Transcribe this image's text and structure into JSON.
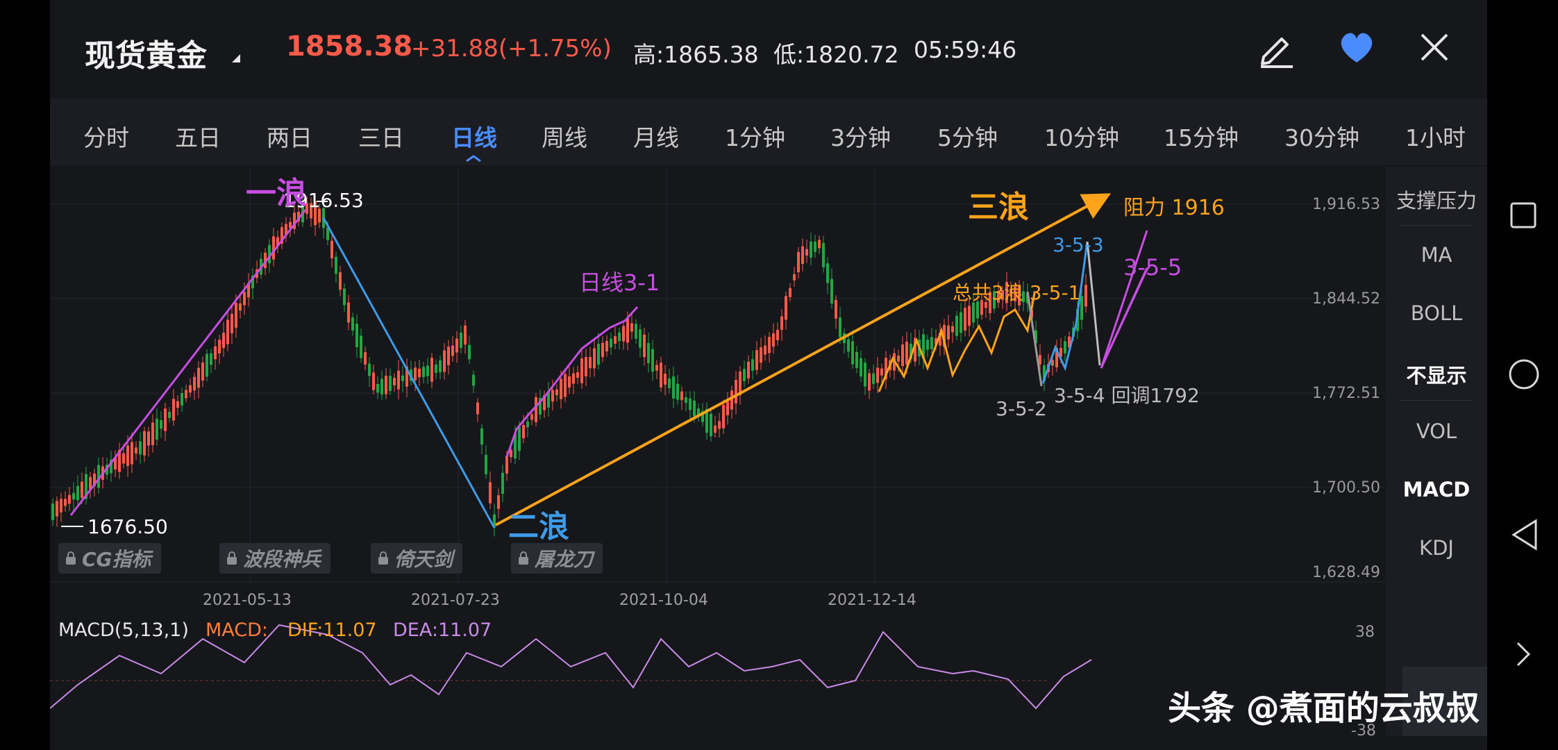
{
  "header": {
    "title": "现货黄金",
    "price": "1858.38",
    "change": "+31.88(+1.75%)",
    "high": "高:1865.38",
    "low": "低:1820.72",
    "time": "05:59:46"
  },
  "tabs": [
    {
      "label": "分时"
    },
    {
      "label": "五日"
    },
    {
      "label": "两日"
    },
    {
      "label": "三日"
    },
    {
      "label": "日线",
      "active": true
    },
    {
      "label": "周线"
    },
    {
      "label": "月线"
    },
    {
      "label": "1分钟"
    },
    {
      "label": "3分钟"
    },
    {
      "label": "5分钟"
    },
    {
      "label": "10分钟"
    },
    {
      "label": "15分钟"
    },
    {
      "label": "30分钟"
    },
    {
      "label": "1小时"
    }
  ],
  "side_panel": [
    "支撑压力",
    "MA",
    "BOLL",
    "不显示",
    "VOL",
    "MACD",
    "KDJ"
  ],
  "price_axis": [
    "1,916.53",
    "1,844.52",
    "1,772.51",
    "1,700.50",
    "1,628.49"
  ],
  "date_axis": [
    "2021-05-13",
    "2021-07-23",
    "2021-10-04",
    "2021-12-14"
  ],
  "markers": {
    "high": "1916.53",
    "low": "1676.50"
  },
  "indicator_badges": [
    "CG指标",
    "波段神兵",
    "倚天剑",
    "屠龙刀"
  ],
  "annotations": {
    "wave1": "一浪",
    "wave2": "二浪",
    "wave3": "三浪",
    "resistance": "阻力 1916",
    "daily": "日线3-1",
    "total": "总共3浪 3-5-1",
    "w352": "3-5-2",
    "w353": "3-5-3",
    "w354": "3-5-4 回调1792",
    "w355": "3-5-5"
  },
  "macd": {
    "name": "MACD(5,13,1)",
    "macd": "MACD:",
    "dif": "DIF:11.07",
    "dea": "DEA:11.07",
    "axis_top": "38",
    "axis_bottom": "-38"
  },
  "watermark": "头条 @煮面的云叔叔",
  "colors": {
    "up": "#ff5a4a",
    "down": "#22a744",
    "accent": "#4a8cff",
    "purple": "#c64ee0",
    "orange": "#ffa31a",
    "blue_line": "#3e9be8",
    "macd_line": "#c98ae8"
  },
  "icons": [
    "edit-icon",
    "heart-icon",
    "close-icon",
    "square-nav-icon",
    "circle-nav-icon",
    "back-nav-icon",
    "chevron-right-icon",
    "lock-icon"
  ]
}
